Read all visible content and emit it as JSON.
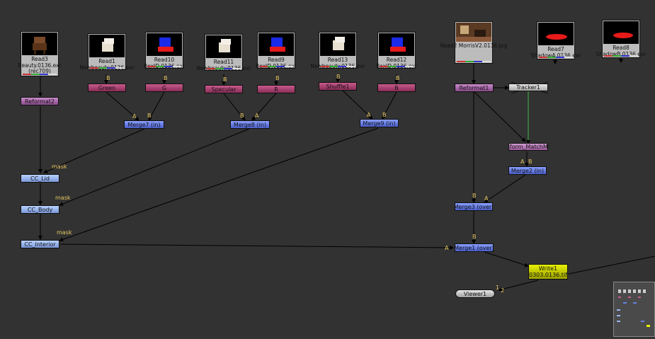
{
  "nodes": {
    "read3": {
      "label": "Read3\nBeauty.0136.exr\n(rec709)",
      "thumb": "chair"
    },
    "read1": {
      "label": "Read1\nNewbeauty.0136.exr"
    },
    "read10": {
      "label": "Read10\nBoxID.0136.exr"
    },
    "read11": {
      "label": "Read11\nNewbeauty.0136.exr"
    },
    "read9": {
      "label": "Read9\nBoxID.0136.exr"
    },
    "read13": {
      "label": "Read13\nNewbeauty.0136.exr"
    },
    "read12": {
      "label": "Read12\nBoxID.0136.exr"
    },
    "read2": {
      "label": "Read2\nMorrisV2.0136.jpg"
    },
    "read7": {
      "label": "Read7\nShadowA.0136.exr"
    },
    "read8": {
      "label": "Read8\nShadowB.0136.exr"
    },
    "shuffle_green": "Green",
    "shuffle_g": "G",
    "shuffle_specular": "Specular",
    "shuffle_r": "R",
    "shuffle1": "Shuffle1",
    "shuffle_b": "B",
    "reformat2": "Reformat2",
    "reformat1": "Reformat1",
    "tracker1": "Tracker1",
    "transform": "Transform_MatchMove1",
    "merge7": "Merge7 (in)",
    "merge8": "Merge8 (in)",
    "merge9": "Merge9 (in)",
    "merge2": "Merge2 (in)",
    "merge3": "Merge3 (over)",
    "merge1": "Merge1 (over)",
    "cc_lid": "CC_Lid",
    "cc_body": "CC_Body",
    "cc_interior": "CC_Interior",
    "write1": {
      "label": "Write1",
      "file": "0303.0136.tif"
    },
    "viewer1": "Viewer1"
  },
  "pipe_labels": {
    "a": "A",
    "b": "B",
    "mask": "mask",
    "viewer_in_1": "1",
    "viewer_in_2": "2"
  },
  "colors": {
    "background": "#323232",
    "pipe": "#000000",
    "tracker_link": "#3fb83f",
    "pipe_label": "#e8c860"
  }
}
